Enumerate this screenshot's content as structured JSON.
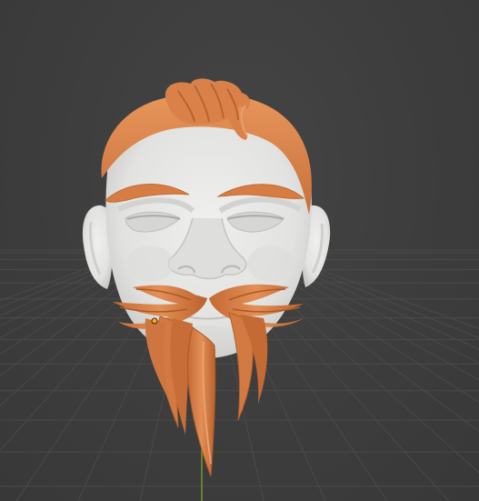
{
  "viewport": {
    "background": "#3d3d3d",
    "grid_color": "#4a4a4a",
    "axis_y_color": "#6a8a2a"
  },
  "model": {
    "skin_color": "#e4e4e2",
    "skin_shadow": "#c9c9c7",
    "hair_color": "#d9834a",
    "hair_shadow": "#b8642f",
    "hair_highlight": "#eda06a",
    "origin_color": "#f5a623"
  }
}
